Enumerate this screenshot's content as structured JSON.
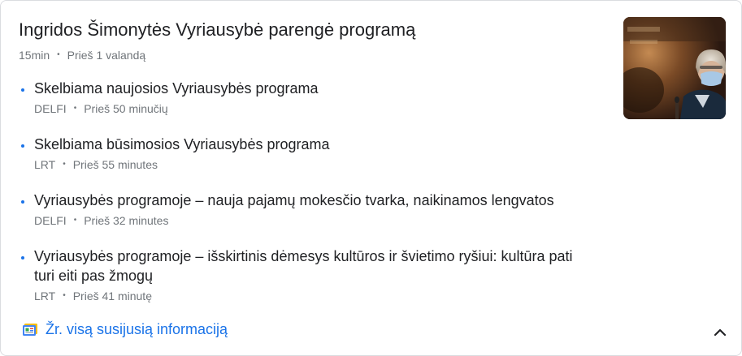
{
  "story": {
    "headline": "Ingridos Šimonytės Vyriausybė parengė programą",
    "source": "15min",
    "time": "Prieš 1 valandą"
  },
  "image": {
    "alt": "Ingrida Šimonytė wearing a face mask"
  },
  "items": [
    {
      "title": "Skelbiama naujosios Vyriausybės programa",
      "source": "DELFI",
      "time": "Prieš 50 minučių"
    },
    {
      "title": "Skelbiama būsimosios Vyriausybės programa",
      "source": "LRT",
      "time": "Prieš 55 minutes"
    },
    {
      "title": "Vyriausybės programoje – nauja pajamų mokesčio tvarka, naikinamos lengvatos",
      "source": "DELFI",
      "time": "Prieš 32 minutes"
    },
    {
      "title": "Vyriausybės programoje – išskirtinis dėmesys kultūros ir švietimo ryšiui: kultūra pati turi eiti pas žmogų",
      "source": "LRT",
      "time": "Prieš 41 minutę"
    }
  ],
  "footer": {
    "link_label": "Žr. visą susijusią informaciją",
    "icon": "news-feed-icon",
    "toggle_icon": "chevron-up-icon"
  },
  "colors": {
    "accent": "#1a73e8",
    "meta": "#70757a",
    "text": "#202124",
    "border": "#dadce0"
  }
}
